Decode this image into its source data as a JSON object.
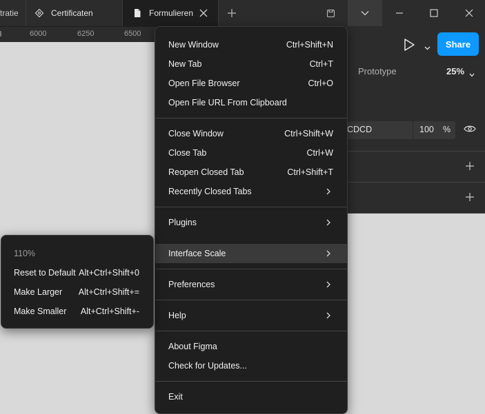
{
  "tabs": [
    {
      "label": "tratie",
      "icon": "none"
    },
    {
      "label": "Certificaten",
      "icon": "component-icon"
    },
    {
      "label": "Formulieren",
      "icon": "file-icon",
      "active": true
    }
  ],
  "ruler": [
    "6000",
    "6250",
    "6500"
  ],
  "panel": {
    "share_label": "Share",
    "prototype_label": "Prototype",
    "zoom": "25%",
    "fill_hex": "CDCD",
    "fill_opacity": "100",
    "percent_sign": "%"
  },
  "menu": {
    "groups": [
      [
        {
          "label": "New Window",
          "shortcut": "Ctrl+Shift+N"
        },
        {
          "label": "New Tab",
          "shortcut": "Ctrl+T"
        },
        {
          "label": "Open File Browser",
          "shortcut": "Ctrl+O"
        },
        {
          "label": "Open File URL From Clipboard",
          "shortcut": ""
        }
      ],
      [
        {
          "label": "Close Window",
          "shortcut": "Ctrl+Shift+W"
        },
        {
          "label": "Close Tab",
          "shortcut": "Ctrl+W"
        },
        {
          "label": "Reopen Closed Tab",
          "shortcut": "Ctrl+Shift+T"
        },
        {
          "label": "Recently Closed Tabs",
          "submenu": true
        }
      ],
      [
        {
          "label": "Plugins",
          "submenu": true
        },
        {
          "label": "Interface Scale",
          "submenu": true,
          "highlighted": true
        }
      ],
      [
        {
          "label": "Preferences",
          "submenu": true
        }
      ],
      [
        {
          "label": "Help",
          "submenu": true
        }
      ],
      [
        {
          "label": "About Figma",
          "shortcut": ""
        },
        {
          "label": "Check for Updates...",
          "shortcut": ""
        }
      ],
      [
        {
          "label": "Exit",
          "shortcut": ""
        }
      ]
    ]
  },
  "submenu": {
    "current_scale": "110%",
    "items": [
      {
        "label": "Reset to Default",
        "shortcut": "Alt+Ctrl+Shift+0"
      },
      {
        "label": "Make Larger",
        "shortcut": "Alt+Ctrl+Shift+="
      },
      {
        "label": "Make Smaller",
        "shortcut": "Alt+Ctrl+Shift+-"
      }
    ]
  }
}
